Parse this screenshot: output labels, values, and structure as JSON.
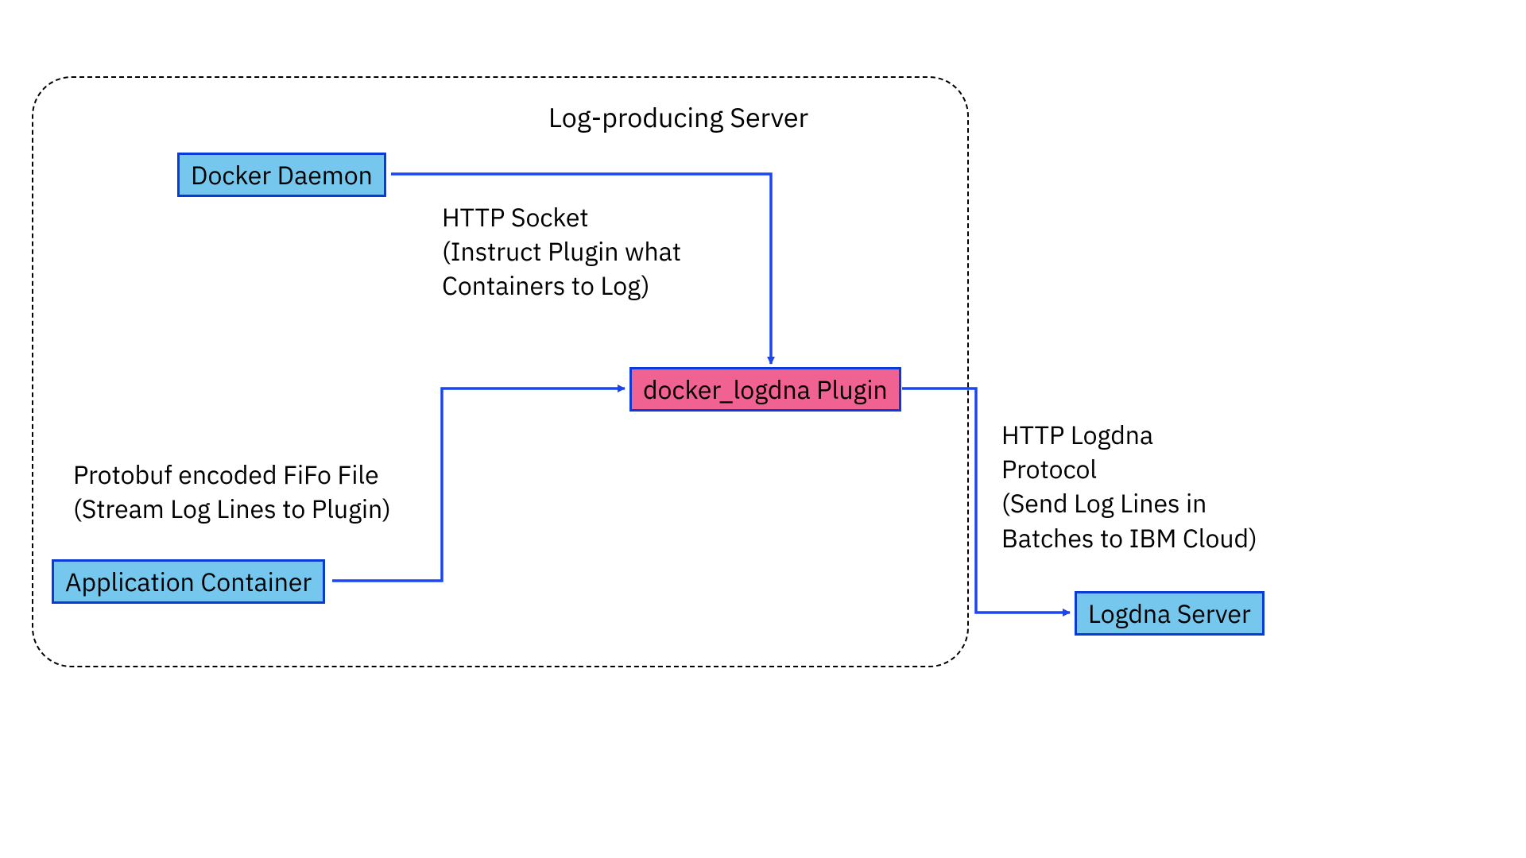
{
  "container": {
    "title": "Log-producing Server"
  },
  "nodes": {
    "docker_daemon": "Docker Daemon",
    "application_container": "Application Container",
    "plugin": "docker_logdna Plugin",
    "logdna_server": "Logdna Server"
  },
  "edges": {
    "http_socket": "HTTP Socket\n(Instruct Plugin what\nContainers to Log)",
    "protobuf_fifo": "Protobuf encoded FiFo File\n(Stream Log Lines to Plugin)",
    "http_logdna_protocol": "HTTP Logdna\nProtocol\n(Send Log Lines in\nBatches to IBM Cloud)"
  },
  "colors": {
    "arrow": "#1a46f0",
    "node_border": "#0b3bd6",
    "node_blue_fill": "#76c7ed",
    "node_pink_fill": "#f06292"
  }
}
